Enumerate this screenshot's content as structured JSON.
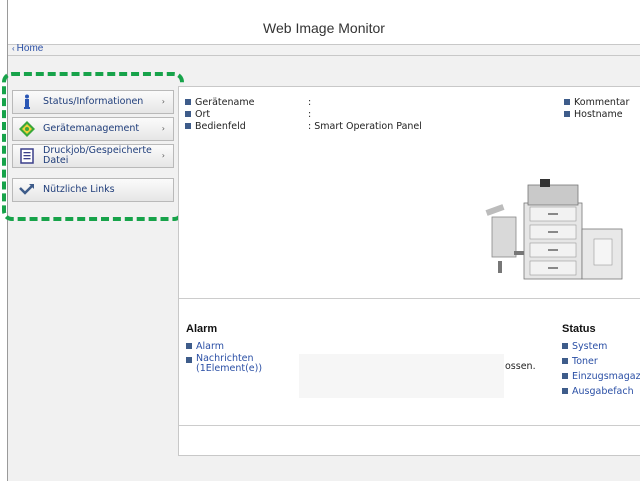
{
  "header": {
    "title": "Web Image Monitor"
  },
  "nav": {
    "home_label": "Home"
  },
  "sidebar": {
    "items": [
      {
        "label": "Status/Informationen",
        "icon": "info-icon"
      },
      {
        "label": "Gerätemanagement",
        "icon": "device-management-icon"
      },
      {
        "label_line1": "Druckjob/Gespeicherte",
        "label_line2": "Datei",
        "icon": "document-icon"
      },
      {
        "label": "Nützliche Links",
        "icon": "link-arrow-icon"
      }
    ]
  },
  "device_info": {
    "rows": [
      {
        "label": "Gerätename",
        "value": ":"
      },
      {
        "label": "Ort",
        "value": ":"
      },
      {
        "label": "Bedienfeld",
        "value": ": Smart Operation Panel"
      }
    ],
    "right_rows": [
      {
        "label": "Kommentar"
      },
      {
        "label": "Hostname"
      }
    ]
  },
  "alarm": {
    "title": "Alarm",
    "links": [
      {
        "label": "Alarm"
      },
      {
        "label_line1": "Nachrichten",
        "label_line2": "(1Element(e))"
      }
    ],
    "partial_text": "ossen."
  },
  "status": {
    "title": "Status",
    "links": [
      "System",
      "Toner",
      "Einzugsmagaz",
      "Ausgabefach"
    ]
  },
  "colors": {
    "accent_link": "#2a4fa5",
    "highlight": "#17a34a",
    "bullet": "#3e5c8a"
  }
}
